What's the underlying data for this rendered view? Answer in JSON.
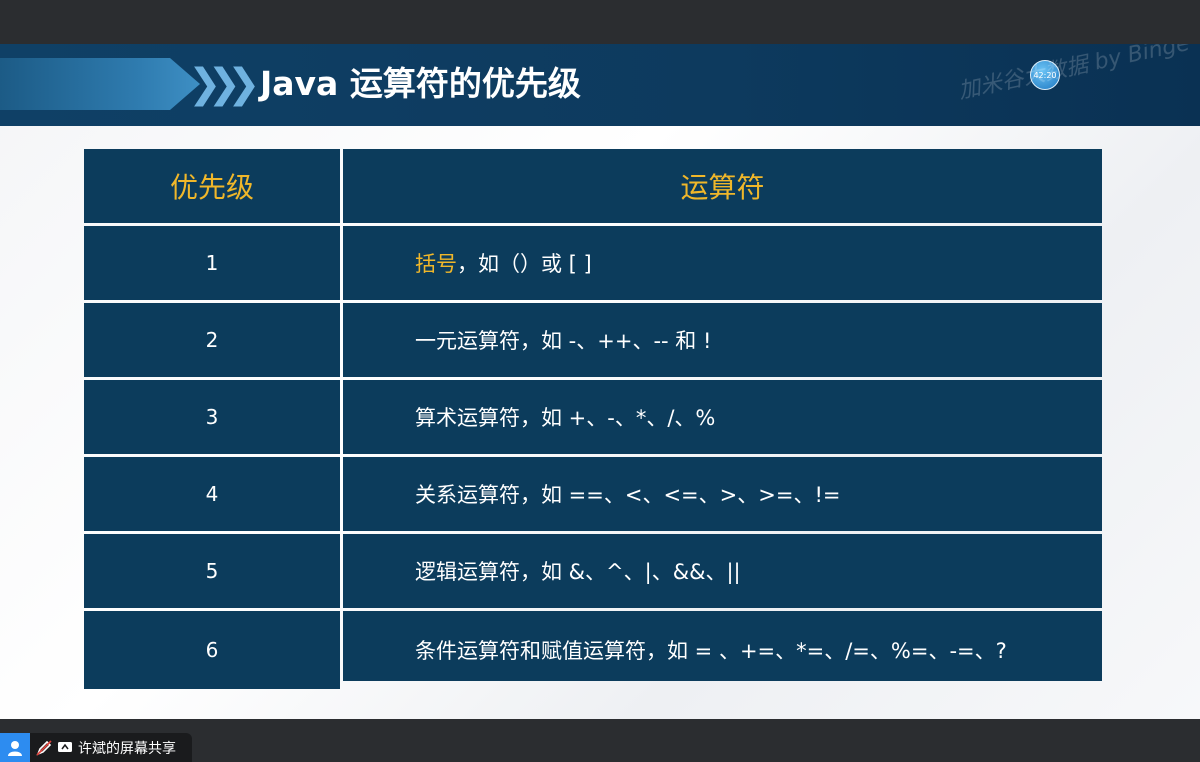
{
  "slide": {
    "title": "Java 运算符的优先级",
    "timer": "42:20",
    "watermark": "加米谷大数据 by Binge"
  },
  "table": {
    "headers": [
      "优先级",
      "运算符"
    ],
    "rows": [
      {
        "priority": "1",
        "highlight": "括号",
        "operators": "，如（）或 [ ]"
      },
      {
        "priority": "2",
        "highlight": "",
        "operators": "一元运算符，如 -、++、-- 和 !"
      },
      {
        "priority": "3",
        "highlight": "",
        "operators": "算术运算符，如 +、-、*、/、%"
      },
      {
        "priority": "4",
        "highlight": "",
        "operators": "关系运算符，如 ==、<、<=、>、>=、!="
      },
      {
        "priority": "5",
        "highlight": "",
        "operators": "逻辑运算符，如 &、^、|、&&、||"
      },
      {
        "priority": "6",
        "highlight": "",
        "operators": "条件运算符和赋值运算符，如 = 、+=、*=、/=、%=、-=、?"
      }
    ]
  },
  "share_bar": {
    "label": "许斌的屏幕共享"
  },
  "colors": {
    "header_bg": "#0d3a5e",
    "cell_bg": "#0c3c5c",
    "accent": "#f0b72a"
  },
  "icons": [
    "user-icon",
    "pen-icon",
    "screen-share-icon"
  ]
}
